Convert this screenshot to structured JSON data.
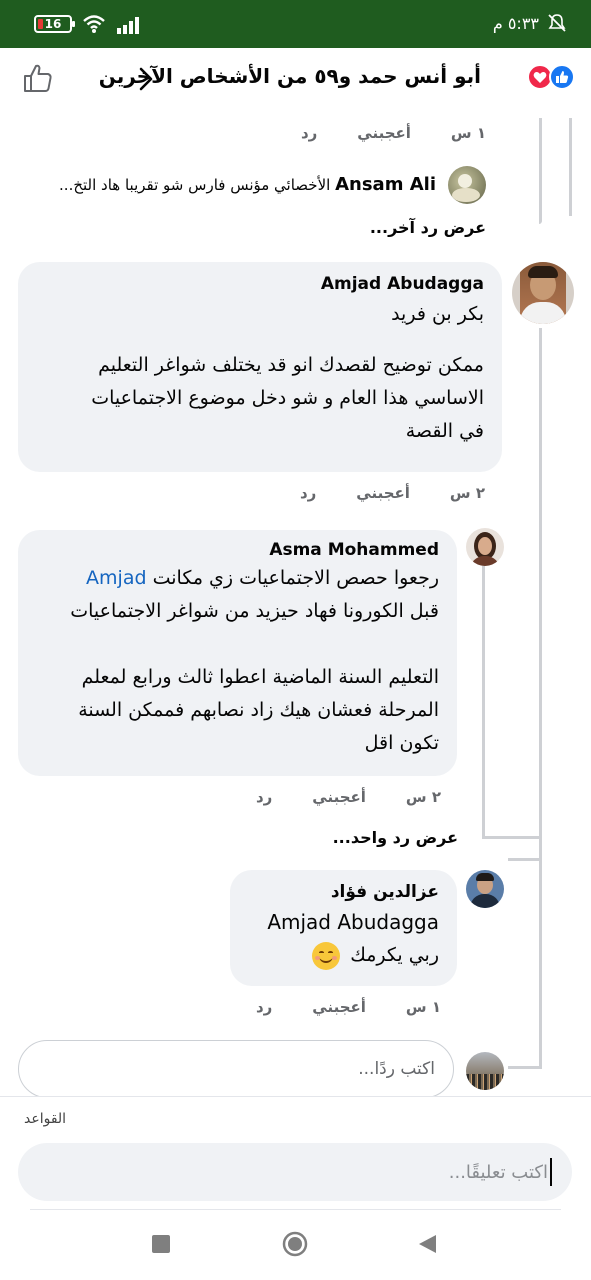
{
  "status_bar": {
    "time": "٥:٣٣ م",
    "battery": "16",
    "battery_fraction": 0.16
  },
  "header": {
    "title": "أبو أنس حمد و٥٩ من الأشخاص الآخرين",
    "reactions": [
      "like-icon",
      "love-icon"
    ]
  },
  "thread": {
    "top_actions": {
      "time": "١ س",
      "like": "أعجبني",
      "reply": "رد"
    },
    "nested_reply": {
      "author": "Ansam Ali",
      "text": "الأخصائي مؤنس فارس شو تقريبا هاد التخ..."
    },
    "view_more_top": "عرض رد آخر...",
    "comments": [
      {
        "author": "Amjad Abudagga",
        "mention": "بكر بن فريد",
        "lines": [
          "ممكن توضيح لقصدك انو قد يختلف شواغر التعليم",
          "الاساسي هذا العام و شو دخل موضوع الاجتماعيات",
          "في القصة"
        ],
        "time": "٢ س",
        "like": "أعجبني",
        "reply": "رد"
      },
      {
        "author": "Asma Mohammed",
        "line1_text": "رجعوا حصص الاجتماعيات زي مكانت",
        "line1_mention": "Amjad",
        "lines": [
          "قبل الكورونا فهاد حيزيد من شواغر الاجتماعيات",
          "",
          "التعليم السنة الماضية اعطوا ثالث ورابع لمعلم",
          "المرحلة فعشان هيك زاد نصابهم فممكن السنة",
          "تكون اقل"
        ],
        "time": "٢ س",
        "like": "أعجبني",
        "reply": "رد"
      },
      {
        "author": "عزالدين فؤاد",
        "mention": "Amjad Abudagga",
        "text": "ربي يكرمك",
        "emoji": "😊",
        "time": "١ س",
        "like": "أعجبني",
        "reply": "رد"
      }
    ],
    "view_more_mid": "عرض رد واحد...",
    "reply_placeholder": "اكتب ردًا..."
  },
  "footer": {
    "rules_label": "القواعد",
    "comment_placeholder": "اكتب تعليقًا..."
  },
  "colors": {
    "status_bar": "#1f5c1f",
    "link": "#1565c0",
    "bubble": "#f0f2f5",
    "like": "#1877f2",
    "love": "#f0284a"
  }
}
